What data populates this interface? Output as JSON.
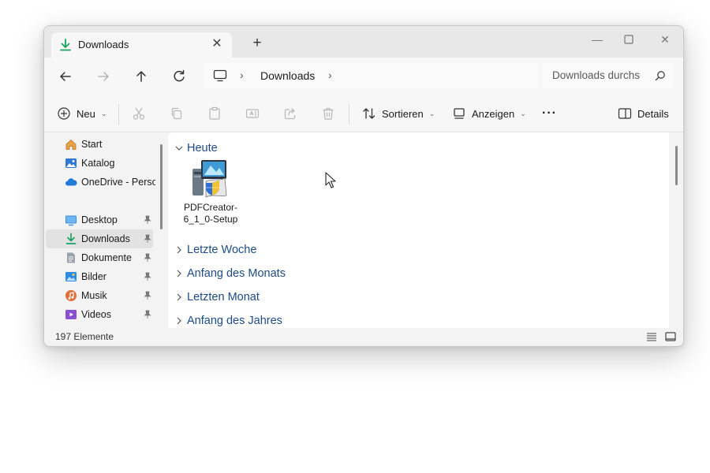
{
  "window": {
    "tab_title": "Downloads",
    "tab_icon": "download-icon",
    "new_tab": "+"
  },
  "address": {
    "crumbs": [
      "Downloads"
    ],
    "search_placeholder": "Downloads durchsuchen"
  },
  "toolbar": {
    "new_label": "Neu",
    "sort_label": "Sortieren",
    "view_label": "Anzeigen",
    "details_label": "Details",
    "more_label": "···"
  },
  "sidebar": {
    "items": [
      {
        "label": "Start",
        "icon": "home-icon",
        "pinned": false
      },
      {
        "label": "Katalog",
        "icon": "gallery-icon",
        "pinned": false
      },
      {
        "label": "OneDrive - Personal",
        "icon": "onedrive-icon",
        "pinned": false
      },
      {
        "label": "Desktop",
        "icon": "desktop-icon",
        "pinned": true
      },
      {
        "label": "Downloads",
        "icon": "download-icon",
        "pinned": true,
        "selected": true
      },
      {
        "label": "Dokumente",
        "icon": "document-icon",
        "pinned": true
      },
      {
        "label": "Bilder",
        "icon": "pictures-icon",
        "pinned": true
      },
      {
        "label": "Musik",
        "icon": "music-icon",
        "pinned": true
      },
      {
        "label": "Videos",
        "icon": "videos-icon",
        "pinned": true
      }
    ]
  },
  "content": {
    "groups": [
      {
        "label": "Heute",
        "expanded": true
      },
      {
        "label": "Letzte Woche",
        "expanded": false
      },
      {
        "label": "Anfang des Monats",
        "expanded": false
      },
      {
        "label": "Letzten Monat",
        "expanded": false
      },
      {
        "label": "Anfang des Jahres",
        "expanded": false
      }
    ],
    "files": [
      {
        "name": "PDFCreator-6_1_0-Setup",
        "icon": "installer-icon"
      }
    ]
  },
  "status": {
    "count": "197 Elemente"
  },
  "colors": {
    "accent": "#1e4b87",
    "download_green": "#1aa260",
    "selected_bg": "#e2e2e2"
  }
}
